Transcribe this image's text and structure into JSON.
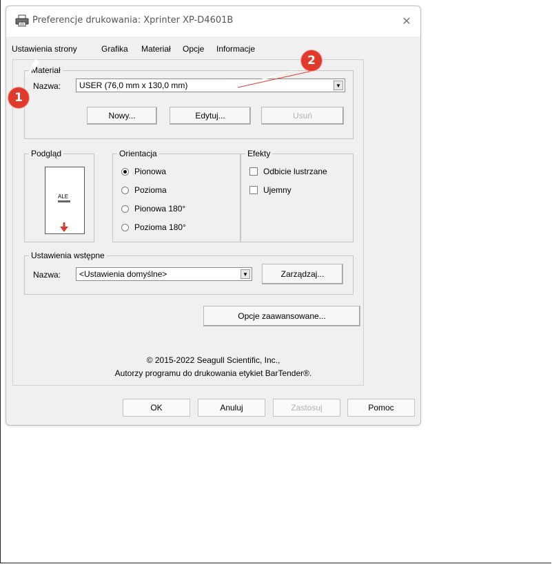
{
  "window": {
    "title": "Preferencje drukowania: Xprinter XP-D4601B",
    "close_glyph": "✕"
  },
  "tabs": [
    {
      "label": "Ustawienia strony"
    },
    {
      "label": "Grafika"
    },
    {
      "label": "Materiał"
    },
    {
      "label": "Opcje"
    },
    {
      "label": "Informacje"
    }
  ],
  "material": {
    "group_label": "Materiał",
    "name_label": "Nazwa:",
    "selected": "USER (76,0 mm x 130,0 mm)",
    "new_label": "Nowy...",
    "edit_label": "Edytuj...",
    "delete_label": "Usuń"
  },
  "preview": {
    "group_label": "Podgląd",
    "card_text": "ALE",
    "arrow_color": "#d83a2c"
  },
  "orientation": {
    "group_label": "Orientacja",
    "options": [
      "Pionowa",
      "Pozioma",
      "Pionowa 180°",
      "Pozioma 180°"
    ],
    "selected": "Pionowa"
  },
  "effects": {
    "group_label": "Efekty",
    "options": [
      "Odbicie lustrzane",
      "Ujemny"
    ]
  },
  "presets": {
    "group_label": "Ustawienia wstępne",
    "name_label": "Nazwa:",
    "selected": "<Ustawienia domyślne>",
    "manage_label": "Zarządzaj..."
  },
  "advanced_label": "Opcje zaawansowane...",
  "copyright": {
    "line1": "© 2015-2022 Seagull Scientific, Inc.,",
    "line2": "Autorzy programu do drukowania etykiet BarTender®."
  },
  "buttons": {
    "ok": "OK",
    "cancel": "Anuluj",
    "apply": "Zastosuj",
    "help": "Pomoc"
  },
  "annotations": {
    "badge1": "1",
    "badge2": "2",
    "badge_color": "#e03a2c"
  }
}
